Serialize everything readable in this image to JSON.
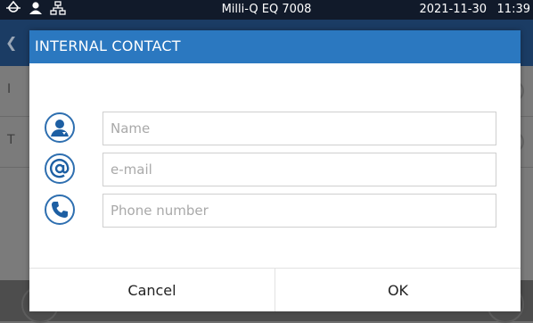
{
  "status_bar": {
    "title": "Milli-Q EQ 7008",
    "date": "2021-11-30",
    "time": "11:39",
    "icons": [
      "water-drop-icon",
      "user-icon",
      "network-icon"
    ]
  },
  "background": {
    "rows": [
      {
        "label": "I"
      },
      {
        "label": "T"
      }
    ]
  },
  "dialog": {
    "title": "INTERNAL CONTACT",
    "fields": [
      {
        "icon": "person-icon",
        "placeholder": "Name",
        "value": ""
      },
      {
        "icon": "at-sign-icon",
        "placeholder": "e-mail",
        "value": ""
      },
      {
        "icon": "phone-icon",
        "placeholder": "Phone number",
        "value": ""
      }
    ],
    "cancel_label": "Cancel",
    "ok_label": "OK"
  },
  "colors": {
    "accent": "#2b78c0",
    "status_bar_bg": "#111a2a",
    "icon_blue": "#1d5fa3"
  }
}
